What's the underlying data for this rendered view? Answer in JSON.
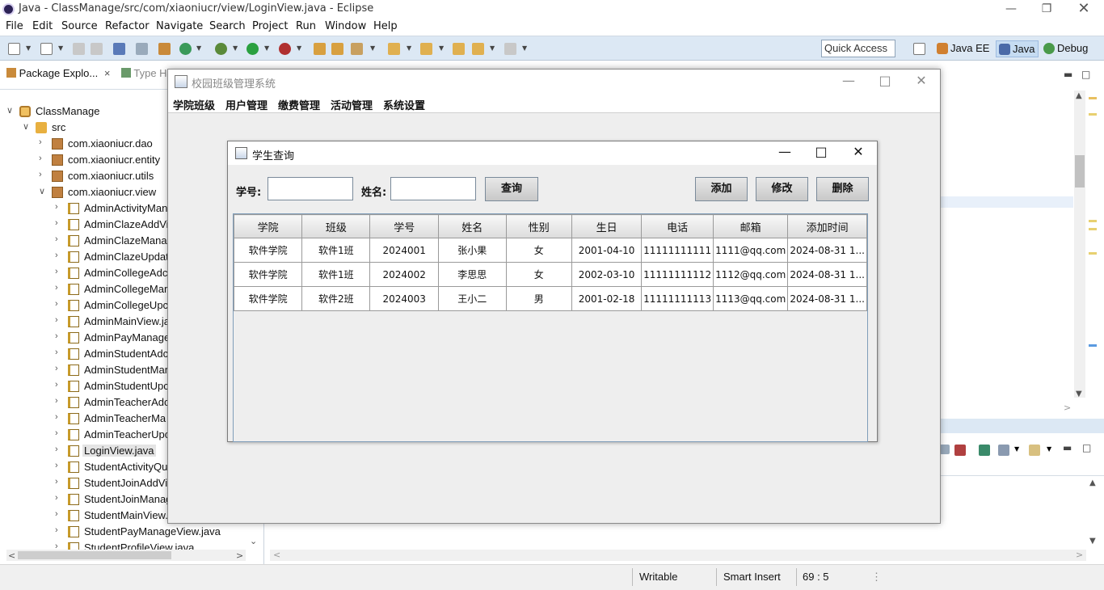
{
  "window": {
    "title": "Java - ClassManage/src/com/xiaoniucr/view/LoginView.java - Eclipse"
  },
  "menubar": [
    "File",
    "Edit",
    "Source",
    "Refactor",
    "Navigate",
    "Search",
    "Project",
    "Run",
    "Window",
    "Help"
  ],
  "toolbar": {
    "quick_access": "Quick Access",
    "perspectives": [
      "Java EE",
      "Java",
      "Debug"
    ]
  },
  "package_explorer": {
    "tab_label": "Package Explo...",
    "tab2_label": "Type H",
    "tree": [
      {
        "label": "ClassManage",
        "icon": "project-icon",
        "twisty": "open"
      },
      {
        "label": "src",
        "icon": "source-folder-icon",
        "twisty": "open"
      },
      {
        "label": "com.xiaoniucr.dao",
        "icon": "package-icon",
        "twisty": "closed"
      },
      {
        "label": "com.xiaoniucr.entity",
        "icon": "package-icon",
        "twisty": "closed"
      },
      {
        "label": "com.xiaoniucr.utils",
        "icon": "package-icon",
        "twisty": "closed"
      },
      {
        "label": "com.xiaoniucr.view",
        "icon": "package-icon",
        "twisty": "open"
      },
      {
        "label": "AdminActivityMan",
        "icon": "java-file-icon",
        "twisty": "closed"
      },
      {
        "label": "AdminClazeAddVi",
        "icon": "java-file-icon",
        "twisty": "closed"
      },
      {
        "label": "AdminClazeMana",
        "icon": "java-file-icon",
        "twisty": "closed"
      },
      {
        "label": "AdminClazeUpdat",
        "icon": "java-file-icon",
        "twisty": "closed"
      },
      {
        "label": "AdminCollegeAdc",
        "icon": "java-file-icon",
        "twisty": "closed"
      },
      {
        "label": "AdminCollegeMar",
        "icon": "java-file-icon",
        "twisty": "closed"
      },
      {
        "label": "AdminCollegeUpc",
        "icon": "java-file-icon",
        "twisty": "closed"
      },
      {
        "label": "AdminMainView.ja",
        "icon": "java-file-icon",
        "twisty": "closed"
      },
      {
        "label": "AdminPayManage",
        "icon": "java-file-icon",
        "twisty": "closed"
      },
      {
        "label": "AdminStudentAdc",
        "icon": "java-file-icon",
        "twisty": "closed"
      },
      {
        "label": "AdminStudentMar",
        "icon": "java-file-icon",
        "twisty": "closed"
      },
      {
        "label": "AdminStudentUpc",
        "icon": "java-file-icon",
        "twisty": "closed"
      },
      {
        "label": "AdminTeacherAdc",
        "icon": "java-file-icon",
        "twisty": "closed"
      },
      {
        "label": "AdminTeacherMa",
        "icon": "java-file-icon",
        "twisty": "closed"
      },
      {
        "label": "AdminTeacherUpc",
        "icon": "java-file-icon",
        "twisty": "closed"
      },
      {
        "label": "LoginView.java",
        "icon": "java-file-icon",
        "twisty": "closed",
        "selected": true
      },
      {
        "label": "StudentActivityQu",
        "icon": "java-file-icon",
        "twisty": "closed"
      },
      {
        "label": "StudentJoinAddVi",
        "icon": "java-file-icon",
        "twisty": "closed"
      },
      {
        "label": "StudentJoinManag",
        "icon": "java-file-icon",
        "twisty": "closed"
      },
      {
        "label": "StudentMainView.",
        "icon": "java-file-icon",
        "twisty": "closed"
      },
      {
        "label": "StudentPayManageView.java",
        "icon": "java-file-icon",
        "twisty": "closed"
      },
      {
        "label": "StudentProfileView.java",
        "icon": "java-file-icon",
        "twisty": "closed"
      }
    ]
  },
  "status": {
    "writable": "Writable",
    "insert_mode": "Smart Insert",
    "position": "69 : 5"
  },
  "app": {
    "title": "校园班级管理系统",
    "menu": [
      "学院班级",
      "用户管理",
      "缴费管理",
      "活动管理",
      "系统设置"
    ]
  },
  "dialog": {
    "title": "学生查询",
    "student_no_label": "学号:",
    "student_no_value": "",
    "name_label": "姓名:",
    "name_value": "",
    "query_button": "查询",
    "add_button": "添加",
    "edit_button": "修改",
    "delete_button": "删除",
    "table": {
      "columns": [
        "学院",
        "班级",
        "学号",
        "姓名",
        "性别",
        "生日",
        "电话",
        "邮箱",
        "添加时间"
      ],
      "rows": [
        [
          "软件学院",
          "软件1班",
          "2024001",
          "张小果",
          "女",
          "2001-04-10",
          "11111111111",
          "1111@qq.com",
          "2024-08-31 1..."
        ],
        [
          "软件学院",
          "软件1班",
          "2024002",
          "李思思",
          "女",
          "2002-03-10",
          "11111111112",
          "1112@qq.com",
          "2024-08-31 1..."
        ],
        [
          "软件学院",
          "软件2班",
          "2024003",
          "王小二",
          "男",
          "2001-02-18",
          "11111111113",
          "1113@qq.com",
          "2024-08-31 1..."
        ]
      ]
    }
  }
}
